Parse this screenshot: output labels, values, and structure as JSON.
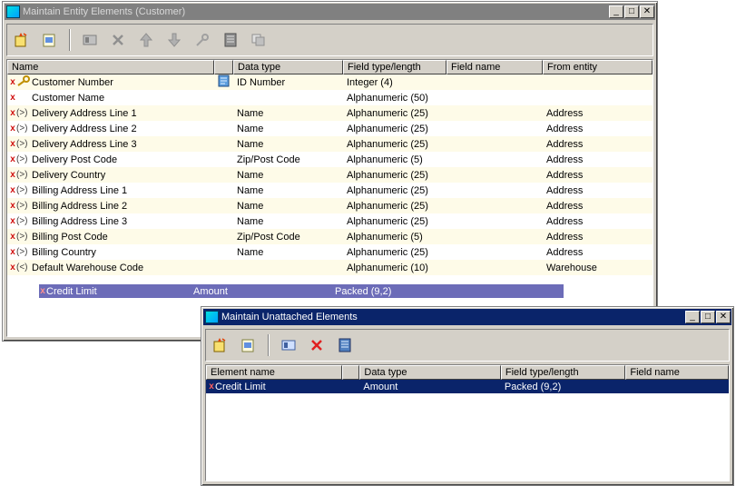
{
  "windows": {
    "entity": {
      "title": "Maintain Entity Elements (Customer)",
      "columns": [
        "Name",
        "Data type",
        "Field type/length",
        "Field name",
        "From entity"
      ],
      "rows": [
        {
          "x": "x",
          "glyph": "key",
          "name": "Customer Number",
          "data_type": "ID Number",
          "field_type": "Integer (4)",
          "field_name": "",
          "from_entity": ""
        },
        {
          "x": "x",
          "glyph": "",
          "name": "Customer Name",
          "data_type": "",
          "field_type": "Alphanumeric (50)",
          "field_name": "",
          "from_entity": ""
        },
        {
          "x": "x",
          "glyph": "(>)",
          "name": "Delivery Address Line 1",
          "data_type": "Name",
          "field_type": "Alphanumeric (25)",
          "field_name": "",
          "from_entity": "Address"
        },
        {
          "x": "x",
          "glyph": "(>)",
          "name": "Delivery Address Line 2",
          "data_type": "Name",
          "field_type": "Alphanumeric (25)",
          "field_name": "",
          "from_entity": "Address"
        },
        {
          "x": "x",
          "glyph": "(>)",
          "name": "Delivery Address Line 3",
          "data_type": "Name",
          "field_type": "Alphanumeric (25)",
          "field_name": "",
          "from_entity": "Address"
        },
        {
          "x": "x",
          "glyph": "(>)",
          "name": "Delivery Post Code",
          "data_type": "Zip/Post Code",
          "field_type": "Alphanumeric (5)",
          "field_name": "",
          "from_entity": "Address"
        },
        {
          "x": "x",
          "glyph": "(>)",
          "name": "Delivery Country",
          "data_type": "Name",
          "field_type": "Alphanumeric (25)",
          "field_name": "",
          "from_entity": "Address"
        },
        {
          "x": "x",
          "glyph": "(>)",
          "name": "Billing Address Line 1",
          "data_type": "Name",
          "field_type": "Alphanumeric (25)",
          "field_name": "",
          "from_entity": "Address"
        },
        {
          "x": "x",
          "glyph": "(>)",
          "name": "Billing Address Line 2",
          "data_type": "Name",
          "field_type": "Alphanumeric (25)",
          "field_name": "",
          "from_entity": "Address"
        },
        {
          "x": "x",
          "glyph": "(>)",
          "name": "Billing Address Line 3",
          "data_type": "Name",
          "field_type": "Alphanumeric (25)",
          "field_name": "",
          "from_entity": "Address"
        },
        {
          "x": "x",
          "glyph": "(>)",
          "name": "Billing Post Code",
          "data_type": "Zip/Post Code",
          "field_type": "Alphanumeric (5)",
          "field_name": "",
          "from_entity": "Address"
        },
        {
          "x": "x",
          "glyph": "(>)",
          "name": "Billing Country",
          "data_type": "Name",
          "field_type": "Alphanumeric (25)",
          "field_name": "",
          "from_entity": "Address"
        },
        {
          "x": "x",
          "glyph": "(<)",
          "name": "Default Warehouse Code",
          "data_type": "",
          "field_type": "Alphanumeric (10)",
          "field_name": "",
          "from_entity": "Warehouse"
        }
      ],
      "drag_row": {
        "x": "x",
        "name": "Credit Limit",
        "data_type": "Amount",
        "field_type": "Packed (9,2)"
      }
    },
    "unattached": {
      "title": "Maintain Unattached Elements",
      "columns": [
        "Element name",
        "Data type",
        "Field type/length",
        "Field name"
      ],
      "rows": [
        {
          "x": "x",
          "name": "Credit Limit",
          "data_type": "Amount",
          "field_type": "Packed (9,2)",
          "field_name": ""
        }
      ]
    }
  },
  "caption_buttons": {
    "minimize": "_",
    "maximize": "□",
    "close": "✕"
  },
  "colors": {
    "active_title": "#0a246a",
    "inactive_title": "#808080",
    "row_alt": "#fefbe8",
    "selection": "#0a246a",
    "drag_highlight": "#6c6cb8",
    "delete_red": "#d01010"
  }
}
